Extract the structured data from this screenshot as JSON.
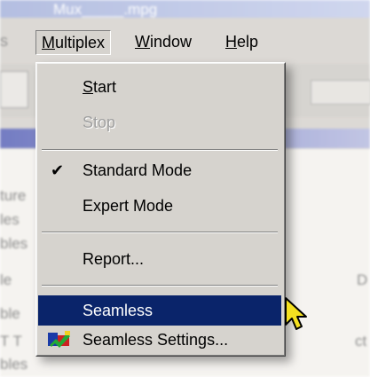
{
  "window": {
    "title": "Mux_____.mpg"
  },
  "menubar": {
    "items": [
      {
        "label": "Multiplex",
        "mnemonic": "M",
        "rest": "ultiplex"
      },
      {
        "label": "Window",
        "mnemonic": "W",
        "rest": "indow"
      },
      {
        "label": "Help",
        "mnemonic": "H",
        "rest": "elp"
      }
    ],
    "prev_fragment": "s"
  },
  "dropdown": {
    "start": {
      "mnemonic": "S",
      "rest": "tart"
    },
    "stop": {
      "label": "Stop"
    },
    "standard_mode": {
      "label": "Standard Mode",
      "checked": true
    },
    "expert_mode": {
      "label": "Expert Mode"
    },
    "report": {
      "label": "Report..."
    },
    "seamless": {
      "label": "Seamless"
    },
    "seamless_settings": {
      "label": "Seamless Settings..."
    }
  },
  "background": {
    "fragments": [
      "ture",
      "les",
      "bles",
      "le",
      "ble",
      "T T",
      "bles",
      "D",
      "ct"
    ]
  },
  "colors": {
    "menu_bg": "#d6d3ce",
    "selection": "#0a246a",
    "disabled_text": "#a0a0a0",
    "title_strip": "#5c66b8"
  },
  "icons": {
    "checkmark": "check-icon",
    "seamless_settings": "seamless-settings-icon",
    "cursor": "arrow-cursor-icon"
  }
}
